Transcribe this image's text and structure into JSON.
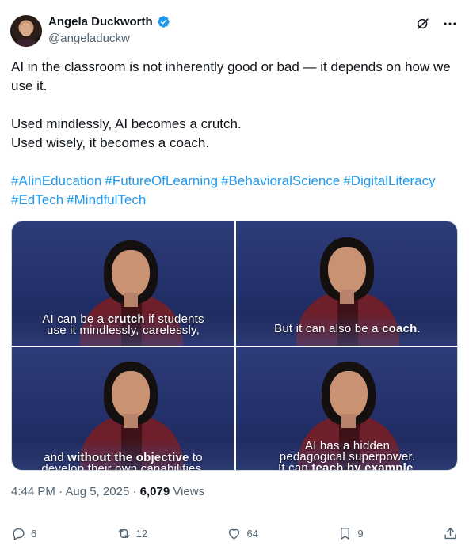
{
  "author": {
    "name": "Angela Duckworth",
    "handle": "@angeladuckw"
  },
  "post": {
    "line1": "AI in the classroom is not inherently good or bad — it depends on how we use it.",
    "line2": "Used mindlessly, AI becomes a crutch.",
    "line3": "Used wisely, it becomes a coach.",
    "hashtags": [
      "#AIinEducation",
      "#FutureOfLearning",
      "#BehavioralScience",
      "#DigitalLiteracy",
      "#EdTech",
      "#MindfulTech"
    ]
  },
  "media": {
    "panel1": {
      "a": "AI can be a ",
      "b": "crutch",
      "c": " if students",
      "d": "use it mindlessly, carelessly,"
    },
    "panel2": {
      "a": "But it can also be a ",
      "b": "coach",
      "c": "."
    },
    "panel3": {
      "a": "and ",
      "b": "without the objective",
      "c": " to",
      "d": "develop their own capabilities."
    },
    "panel4": {
      "l1": "AI has a hidden",
      "l2": "pedagogical superpower.",
      "a": "It can ",
      "b": "teach by example",
      "c": "."
    }
  },
  "meta": {
    "time": "4:44 PM",
    "sep1": " · ",
    "date": "Aug 5, 2025",
    "sep2": " · ",
    "views_count": "6,079",
    "views_label": " Views"
  },
  "actions": {
    "replies": "6",
    "reposts": "12",
    "likes": "64",
    "bookmarks": "9"
  },
  "colors": {
    "link": "#1d9bf0",
    "secondary": "#536471",
    "verified": "#1d9bf0",
    "frame_bg": "#2d3b78"
  },
  "icons": [
    "verified-badge-icon",
    "grok-icon",
    "more-icon",
    "reply-icon",
    "repost-icon",
    "like-icon",
    "bookmark-icon",
    "share-icon"
  ]
}
